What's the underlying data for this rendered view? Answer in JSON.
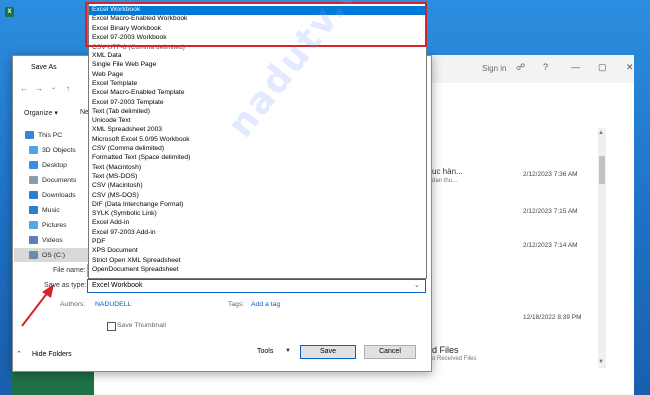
{
  "colors": {
    "accent": "#0078d7",
    "annotation": "#d8232a",
    "excel_green": "#1e7145"
  },
  "excel": {
    "signin": "Sign in",
    "window_controls": [
      "?",
      "—",
      "▢",
      "✕"
    ],
    "recent": [
      {
        "title": "uc hàn...",
        "sub": "dan thu...",
        "date": "2/12/2023 7:36 AM"
      },
      {
        "title": "",
        "sub": "",
        "date": "2/12/2023 7:15 AM"
      },
      {
        "title": "",
        "sub": "",
        "date": "2/12/2023 7:14 AM"
      },
      {
        "title": "",
        "sub": "",
        "date": "12/18/2022 8:39 PM"
      },
      {
        "title": "d Files",
        "sub": "o Received Files",
        "date": ""
      }
    ]
  },
  "dialog": {
    "title": "Save As",
    "organize": "Organize ▾",
    "new_folder_partial": "Ne",
    "nav": [
      {
        "label": "This PC",
        "icon": "monitor-icon",
        "color": "#3a84d6"
      },
      {
        "label": "3D Objects",
        "icon": "cube-icon",
        "color": "#58a0e4"
      },
      {
        "label": "Desktop",
        "icon": "desktop-icon",
        "color": "#3a8fe0"
      },
      {
        "label": "Documents",
        "icon": "documents-icon",
        "color": "#8a9bb0"
      },
      {
        "label": "Downloads",
        "icon": "download-icon",
        "color": "#2d7dd2"
      },
      {
        "label": "Music",
        "icon": "music-icon",
        "color": "#2d7dd2"
      },
      {
        "label": "Pictures",
        "icon": "pictures-icon",
        "color": "#5aa5e8"
      },
      {
        "label": "Videos",
        "icon": "videos-icon",
        "color": "#5a7fb8"
      },
      {
        "label": "OS (C:)",
        "icon": "drive-icon",
        "color": "#6e8aa8"
      }
    ],
    "file_name_label": "File name:",
    "save_as_type_label": "Save as type:",
    "save_as_type_value": "Excel Workbook",
    "authors_label": "Authors:",
    "authors_value": "NADUDELL",
    "tags_label": "Tags:",
    "tags_value": "Add a tag",
    "save_thumbnail": "Save Thumbnail",
    "hide_folders": "Hide Folders",
    "tools": "Tools",
    "save": "Save",
    "cancel": "Cancel"
  },
  "dropdown": {
    "items": [
      "Excel Workbook",
      "Excel Macro-Enabled Workbook",
      "Excel Binary Workbook",
      "Excel 97-2003 Workbook",
      "CSV UTF-8 (Comma delimited)",
      "XML Data",
      "Single File Web Page",
      "Web Page",
      "Excel Template",
      "Excel Macro-Enabled Template",
      "Excel 97-2003 Template",
      "Text (Tab delimited)",
      "Unicode Text",
      "XML Spreadsheet 2003",
      "Microsoft Excel 5.0/95 Workbook",
      "CSV (Comma delimited)",
      "Formatted Text (Space delimited)",
      "Text (Macintosh)",
      "Text (MS-DOS)",
      "CSV (Macintosh)",
      "CSV (MS-DOS)",
      "DIF (Data Interchange Format)",
      "SYLK (Symbolic Link)",
      "Excel Add-in",
      "Excel 97-2003 Add-in",
      "PDF",
      "XPS Document",
      "Strict Open XML Spreadsheet",
      "OpenDocument Spreadsheet"
    ]
  },
  "watermark": "nadutv.com"
}
